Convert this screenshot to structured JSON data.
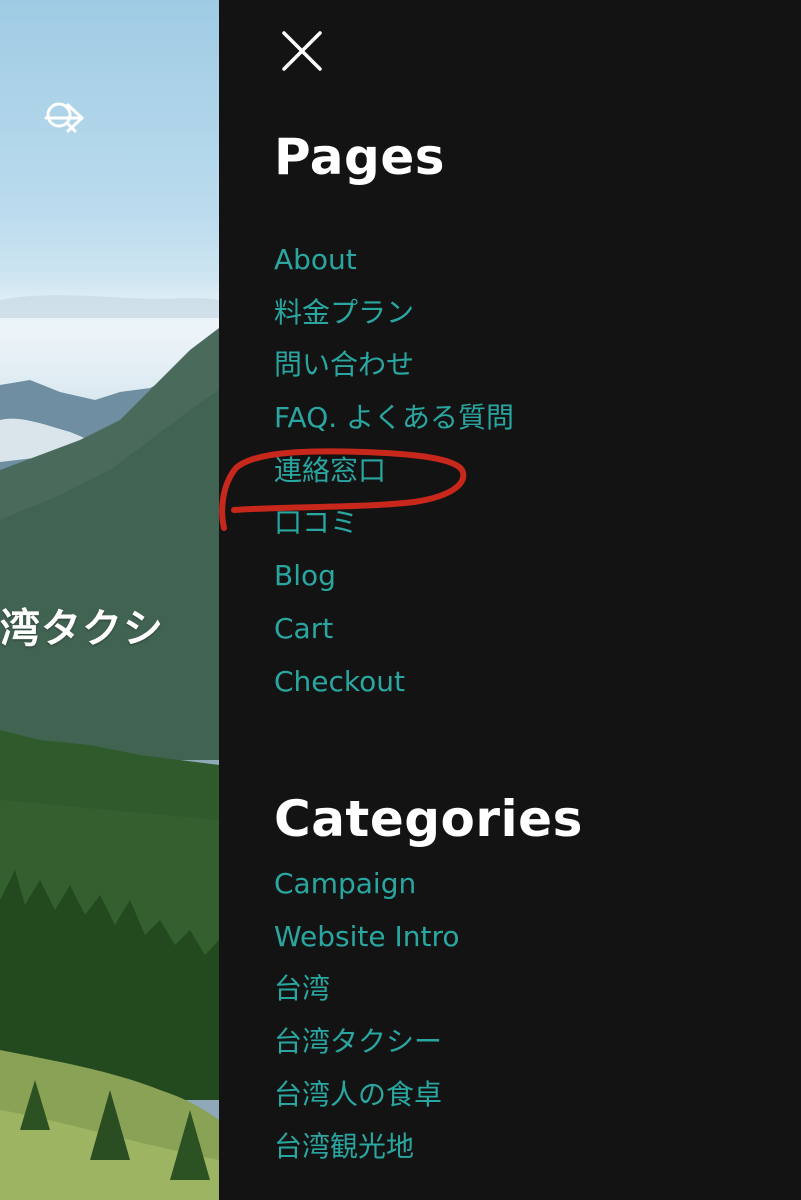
{
  "hero": {
    "title": "湾タクシ",
    "icons": [
      "search-icon",
      "arrow-right-icon"
    ]
  },
  "drawer": {
    "close_icon": "close-icon",
    "pages_title": "Pages",
    "pages": [
      {
        "label": "About"
      },
      {
        "label": "料金プラン"
      },
      {
        "label": "問い合わせ"
      },
      {
        "label": "FAQ. よくある質問"
      },
      {
        "label": "連絡窓口"
      },
      {
        "label": "口コミ"
      },
      {
        "label": "Blog"
      },
      {
        "label": "Cart"
      },
      {
        "label": "Checkout"
      }
    ],
    "categories_title": "Categories",
    "categories": [
      {
        "label": "Campaign"
      },
      {
        "label": "Website Intro"
      },
      {
        "label": "台湾"
      },
      {
        "label": "台湾タクシー"
      },
      {
        "label": "台湾人の食卓"
      },
      {
        "label": "台湾観光地"
      }
    ]
  },
  "colors": {
    "drawer_bg": "#131313",
    "link": "#2aa6a0",
    "heading": "#ffffff",
    "annotation": "#c8281c"
  }
}
